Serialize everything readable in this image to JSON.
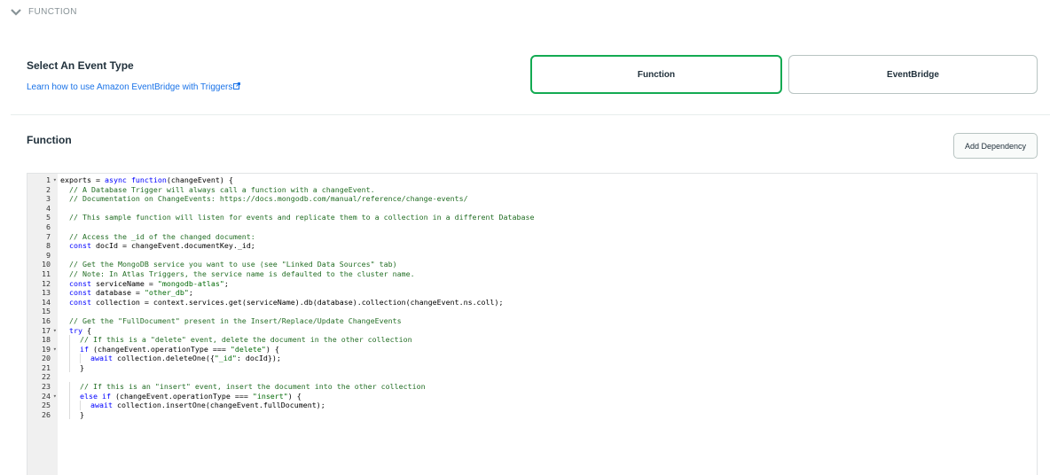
{
  "section": {
    "title": "FUNCTION",
    "icon": "chevron-down-icon"
  },
  "event_type": {
    "heading": "Select An Event Type",
    "link_text": "Learn how to use Amazon EventBridge with Triggers",
    "link_icon": "external-link-icon",
    "options": [
      {
        "label": "Function",
        "selected": true
      },
      {
        "label": "EventBridge",
        "selected": false
      }
    ],
    "accent_color": "#13aa52"
  },
  "function_section": {
    "heading": "Function",
    "add_dependency_label": "Add Dependency"
  },
  "editor": {
    "lines": [
      {
        "n": "1",
        "fold": true,
        "indent": 0,
        "tokens": [
          [
            "",
            "exports = "
          ],
          [
            "kw",
            "async"
          ],
          [
            "",
            " "
          ],
          [
            "kw",
            "function"
          ],
          [
            "",
            "(changeEvent) {"
          ]
        ]
      },
      {
        "n": "2",
        "fold": false,
        "indent": 1,
        "tokens": [
          [
            "cm",
            "// A Database Trigger will always call a function with a changeEvent."
          ]
        ]
      },
      {
        "n": "3",
        "fold": false,
        "indent": 1,
        "tokens": [
          [
            "cm",
            "// Documentation on ChangeEvents: https://docs.mongodb.com/manual/reference/change-events/"
          ]
        ]
      },
      {
        "n": "4",
        "fold": false,
        "indent": 0,
        "tokens": []
      },
      {
        "n": "5",
        "fold": false,
        "indent": 1,
        "tokens": [
          [
            "cm",
            "// This sample function will listen for events and replicate them to a collection in a different Database"
          ]
        ]
      },
      {
        "n": "6",
        "fold": false,
        "indent": 0,
        "tokens": []
      },
      {
        "n": "7",
        "fold": false,
        "indent": 1,
        "tokens": [
          [
            "cm",
            "// Access the _id of the changed document:"
          ]
        ]
      },
      {
        "n": "8",
        "fold": false,
        "indent": 1,
        "tokens": [
          [
            "kw",
            "const"
          ],
          [
            "",
            " docId = changeEvent.documentKey._id;"
          ]
        ]
      },
      {
        "n": "9",
        "fold": false,
        "indent": 0,
        "tokens": []
      },
      {
        "n": "10",
        "fold": false,
        "indent": 1,
        "tokens": [
          [
            "cm",
            "// Get the MongoDB service you want to use (see \"Linked Data Sources\" tab)"
          ]
        ]
      },
      {
        "n": "11",
        "fold": false,
        "indent": 1,
        "tokens": [
          [
            "cm",
            "// Note: In Atlas Triggers, the service name is defaulted to the cluster name."
          ]
        ]
      },
      {
        "n": "12",
        "fold": false,
        "indent": 1,
        "tokens": [
          [
            "kw",
            "const"
          ],
          [
            "",
            " serviceName = "
          ],
          [
            "st",
            "\"mongodb-atlas\""
          ],
          [
            "",
            ";"
          ]
        ]
      },
      {
        "n": "13",
        "fold": false,
        "indent": 1,
        "tokens": [
          [
            "kw",
            "const"
          ],
          [
            "",
            " database = "
          ],
          [
            "st",
            "\"other_db\""
          ],
          [
            "",
            ";"
          ]
        ]
      },
      {
        "n": "14",
        "fold": false,
        "indent": 1,
        "tokens": [
          [
            "kw",
            "const"
          ],
          [
            "",
            " collection = context.services.get(serviceName).db(database).collection(changeEvent.ns.coll);"
          ]
        ]
      },
      {
        "n": "15",
        "fold": false,
        "indent": 0,
        "tokens": []
      },
      {
        "n": "16",
        "fold": false,
        "indent": 1,
        "tokens": [
          [
            "cm",
            "// Get the \"FullDocument\" present in the Insert/Replace/Update ChangeEvents"
          ]
        ]
      },
      {
        "n": "17",
        "fold": true,
        "indent": 1,
        "tokens": [
          [
            "kw",
            "try"
          ],
          [
            "",
            " {"
          ]
        ]
      },
      {
        "n": "18",
        "fold": false,
        "indent": 2,
        "tokens": [
          [
            "cm",
            "// If this is a \"delete\" event, delete the document in the other collection"
          ]
        ]
      },
      {
        "n": "19",
        "fold": true,
        "indent": 2,
        "tokens": [
          [
            "kw",
            "if"
          ],
          [
            "",
            " (changeEvent.operationType === "
          ],
          [
            "st",
            "\"delete\""
          ],
          [
            "",
            ") {"
          ]
        ]
      },
      {
        "n": "20",
        "fold": false,
        "indent": 3,
        "tokens": [
          [
            "kw",
            "await"
          ],
          [
            "",
            " collection.deleteOne({"
          ],
          [
            "st",
            "\"_id\""
          ],
          [
            "",
            ": docId});"
          ]
        ]
      },
      {
        "n": "21",
        "fold": false,
        "indent": 2,
        "tokens": [
          [
            "",
            "}"
          ]
        ]
      },
      {
        "n": "22",
        "fold": false,
        "indent": 0,
        "tokens": []
      },
      {
        "n": "23",
        "fold": false,
        "indent": 2,
        "tokens": [
          [
            "cm",
            "// If this is an \"insert\" event, insert the document into the other collection"
          ]
        ]
      },
      {
        "n": "24",
        "fold": true,
        "indent": 2,
        "tokens": [
          [
            "kw",
            "else if"
          ],
          [
            "",
            " (changeEvent.operationType === "
          ],
          [
            "st",
            "\"insert\""
          ],
          [
            "",
            ") {"
          ]
        ]
      },
      {
        "n": "25",
        "fold": false,
        "indent": 3,
        "tokens": [
          [
            "kw",
            "await"
          ],
          [
            "",
            " collection.insertOne(changeEvent.fullDocument);"
          ]
        ]
      },
      {
        "n": "26",
        "fold": false,
        "indent": 2,
        "tokens": [
          [
            "",
            "}"
          ]
        ]
      }
    ]
  }
}
